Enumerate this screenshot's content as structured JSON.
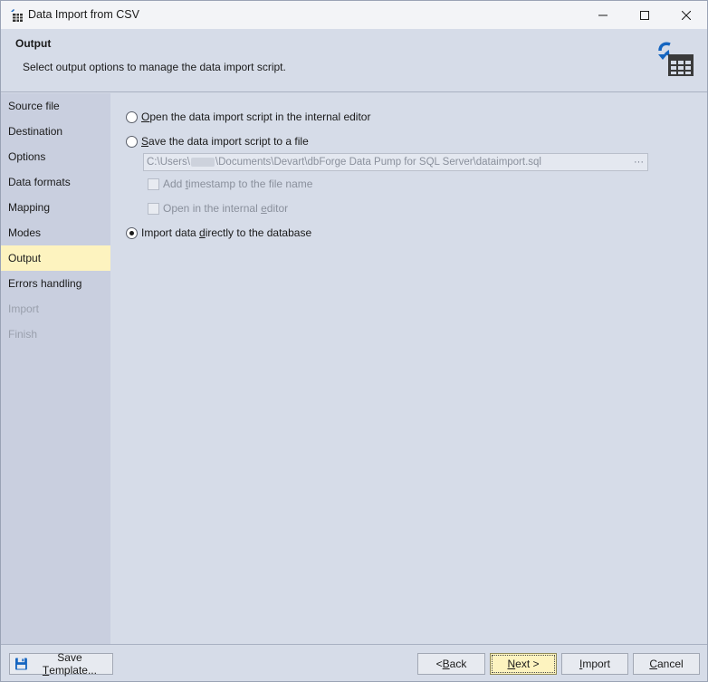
{
  "window": {
    "title": "Data Import from CSV"
  },
  "header": {
    "title": "Output",
    "description": "Select output options to manage the data import script."
  },
  "sidebar": {
    "items": [
      {
        "label": "Source file",
        "state": "normal"
      },
      {
        "label": "Destination",
        "state": "normal"
      },
      {
        "label": "Options",
        "state": "normal"
      },
      {
        "label": "Data formats",
        "state": "normal"
      },
      {
        "label": "Mapping",
        "state": "normal"
      },
      {
        "label": "Modes",
        "state": "normal"
      },
      {
        "label": "Output",
        "state": "active"
      },
      {
        "label": "Errors handling",
        "state": "normal"
      },
      {
        "label": "Import",
        "state": "disabled"
      },
      {
        "label": "Finish",
        "state": "disabled"
      }
    ]
  },
  "output": {
    "open_editor": {
      "mnemonic": "O",
      "rest": "pen the data import script in the internal editor",
      "checked": false
    },
    "save_file": {
      "mnemonic": "S",
      "rest": "ave the data import script to a file",
      "checked": false
    },
    "file_path": {
      "prefix": "C:\\Users\\",
      "suffix": "\\Documents\\Devart\\dbForge Data Pump for SQL Server\\dataimport.sql"
    },
    "file_path_button": "···",
    "add_timestamp": {
      "before": "Add ",
      "mnemonic": "t",
      "after": "imestamp to the file name",
      "checked": false
    },
    "open_internal": {
      "before": "Open in the internal ",
      "mnemonic": "e",
      "after": "ditor",
      "checked": false
    },
    "import_direct": {
      "before": "Import data ",
      "mnemonic": "d",
      "after": "irectly to the database",
      "checked": true
    }
  },
  "footer": {
    "save_template": {
      "before": "Save ",
      "mnemonic": "T",
      "after": "emplate..."
    },
    "back": {
      "before": "< ",
      "mnemonic": "B",
      "after": "ack"
    },
    "next": {
      "before": "",
      "mnemonic": "N",
      "after": "ext >"
    },
    "import": {
      "before": "",
      "mnemonic": "I",
      "after": "mport"
    },
    "cancel": {
      "before": "",
      "mnemonic": "C",
      "after": "ancel"
    }
  },
  "colors": {
    "active_nav": "#fdf3bf",
    "sidebar_bg": "#c9cfdf",
    "main_bg": "#d6dce8",
    "accent_icon": "#1565c0"
  },
  "icons": {
    "app": "table-import-icon",
    "header": "table-import-arrow-icon",
    "save": "floppy-disk-icon"
  }
}
